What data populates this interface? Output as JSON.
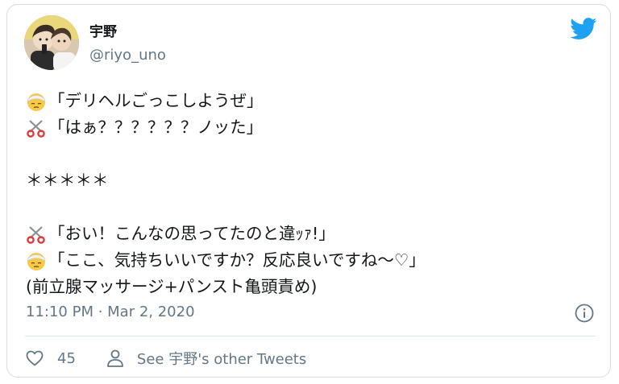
{
  "author": {
    "display_name": "宇野",
    "handle": "@riyo_uno",
    "avatar_icon": "avatar-illustration"
  },
  "brand": {
    "icon": "twitter-bird-icon",
    "color": "#1da1f2"
  },
  "tweet": {
    "lines": [
      {
        "emoji": "bandaged-face-emoji",
        "text": "「デリヘルごっこしようぜ」"
      },
      {
        "emoji": "scissors-emoji",
        "text": "「はぁ？？？？？？ノッた」"
      },
      {
        "emoji": "",
        "text": ""
      },
      {
        "emoji": "",
        "text": "＊＊＊＊＊"
      },
      {
        "emoji": "",
        "text": ""
      },
      {
        "emoji": "scissors-emoji",
        "text": "「おい！こんなの思ってたのと違ｯｧ!」"
      },
      {
        "emoji": "bandaged-face-emoji",
        "text": "「ここ、気持ちいいですか？反応良いですね〜♡」"
      },
      {
        "emoji": "",
        "text": "(前立腺マッサージ+パンスト亀頭責め)"
      }
    ]
  },
  "meta": {
    "timestamp": "11:10 PM · Mar 2, 2020",
    "info_icon": "info-icon"
  },
  "actions": {
    "like_icon": "heart-icon",
    "like_count": "45",
    "profile_icon": "person-icon",
    "profile_label": "See 宇野's other Tweets"
  },
  "colors": {
    "text": "#14171a",
    "secondary": "#657786",
    "border": "#d9dde1"
  }
}
